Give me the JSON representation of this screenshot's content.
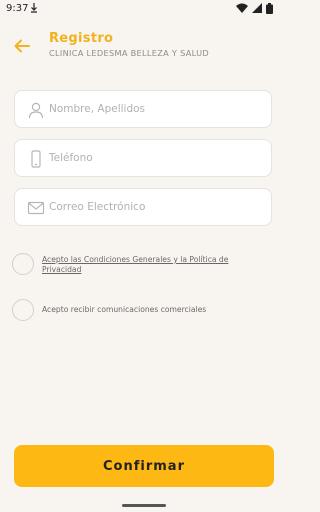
{
  "status_bar": {
    "time": "9:37",
    "icons": [
      "download-icon",
      "wifi-icon",
      "signal-icon",
      "battery-icon"
    ]
  },
  "header": {
    "title": "Registro",
    "subtitle": "CLINICA LEDESMA BELLEZA Y SALUD",
    "accent_color": "#f2b21c"
  },
  "form": {
    "name": {
      "placeholder": "Nombre, Apellidos",
      "value": "",
      "icon": "user-icon"
    },
    "phone": {
      "placeholder": "Teléfono",
      "value": "",
      "icon": "phone-icon"
    },
    "email": {
      "placeholder": "Correo Electrónico",
      "value": "",
      "icon": "mail-icon"
    }
  },
  "checks": {
    "terms_label": "Acepto las Condiciones Generales y la Política de Privacidad",
    "terms_checked": false,
    "commercial_label": "Acepto recibir comunicaciones comerciales",
    "commercial_checked": false
  },
  "actions": {
    "confirm_label": "Confirmar",
    "button_color": "#fdb813"
  }
}
